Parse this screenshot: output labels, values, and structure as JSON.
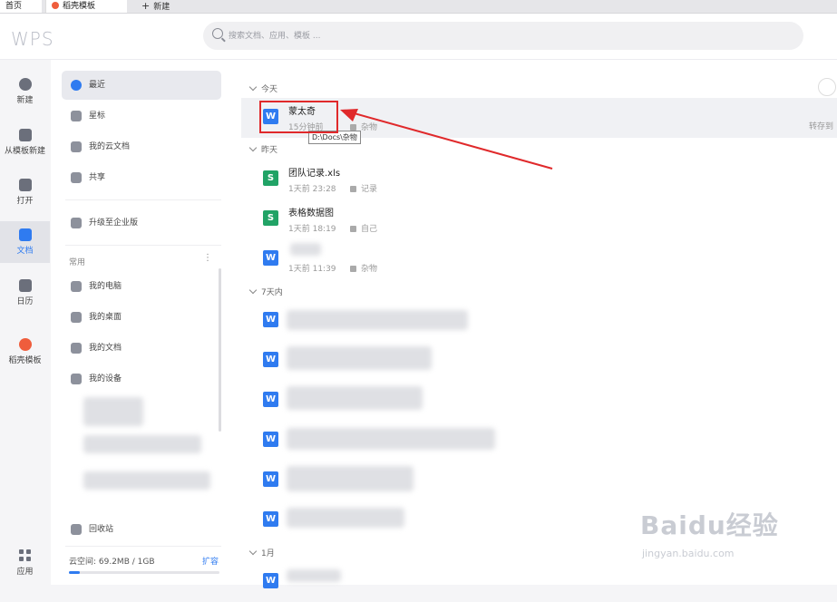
{
  "tabs": {
    "home": "首页",
    "docer": "稻壳模板",
    "new": "新建",
    "new_plus": "+"
  },
  "header": {
    "logo": "WPS",
    "search_placeholder": "搜索文档、应用、模板 ..."
  },
  "rail": {
    "new": "新建",
    "from_template": "从模板新建",
    "open": "打开",
    "docs": "文档",
    "calendar": "日历",
    "docer": "稻壳模板",
    "apps": "应用"
  },
  "sidebar": {
    "recent": "最近",
    "starred": "星标",
    "cloud_docs": "我的云文档",
    "shared": "共享",
    "upgrade": "升级至企业版",
    "common_label": "常用",
    "more": "⋮",
    "my_computer": "我的电脑",
    "my_desktop": "我的桌面",
    "my_documents": "我的文档",
    "my_devices": "我的设备",
    "recycle_bin": "回收站",
    "storage_text": "云空间: 69.2MB / 1GB",
    "expand": "扩容",
    "storage_used_fraction": 0.07
  },
  "main": {
    "groups": {
      "today": "今天",
      "yesterday": "昨天",
      "seven_days": "7天内",
      "one_month": "1月"
    },
    "files": [
      {
        "name": "蒙太奇",
        "time": "15分钟前",
        "location": "杂物",
        "type": "W"
      },
      {
        "name": "团队记录.xls",
        "time": "1天前 23:28",
        "location": "记录",
        "type": "S"
      },
      {
        "name": "表格数据图",
        "time": "1天前 18:19",
        "location": "自己",
        "type": "S"
      },
      {
        "name": "",
        "time": "1天前 11:39",
        "location": "杂物",
        "type": "W"
      }
    ],
    "tooltip": "D:\\Docs\\杂物",
    "transfer_text": "转存到"
  },
  "watermark": {
    "main": "Baidu经验",
    "sub": "jingyan.baidu.com"
  },
  "colors": {
    "accent": "#2f7bf0",
    "spreadsheet": "#21a366",
    "highlight": "#e0292b"
  }
}
